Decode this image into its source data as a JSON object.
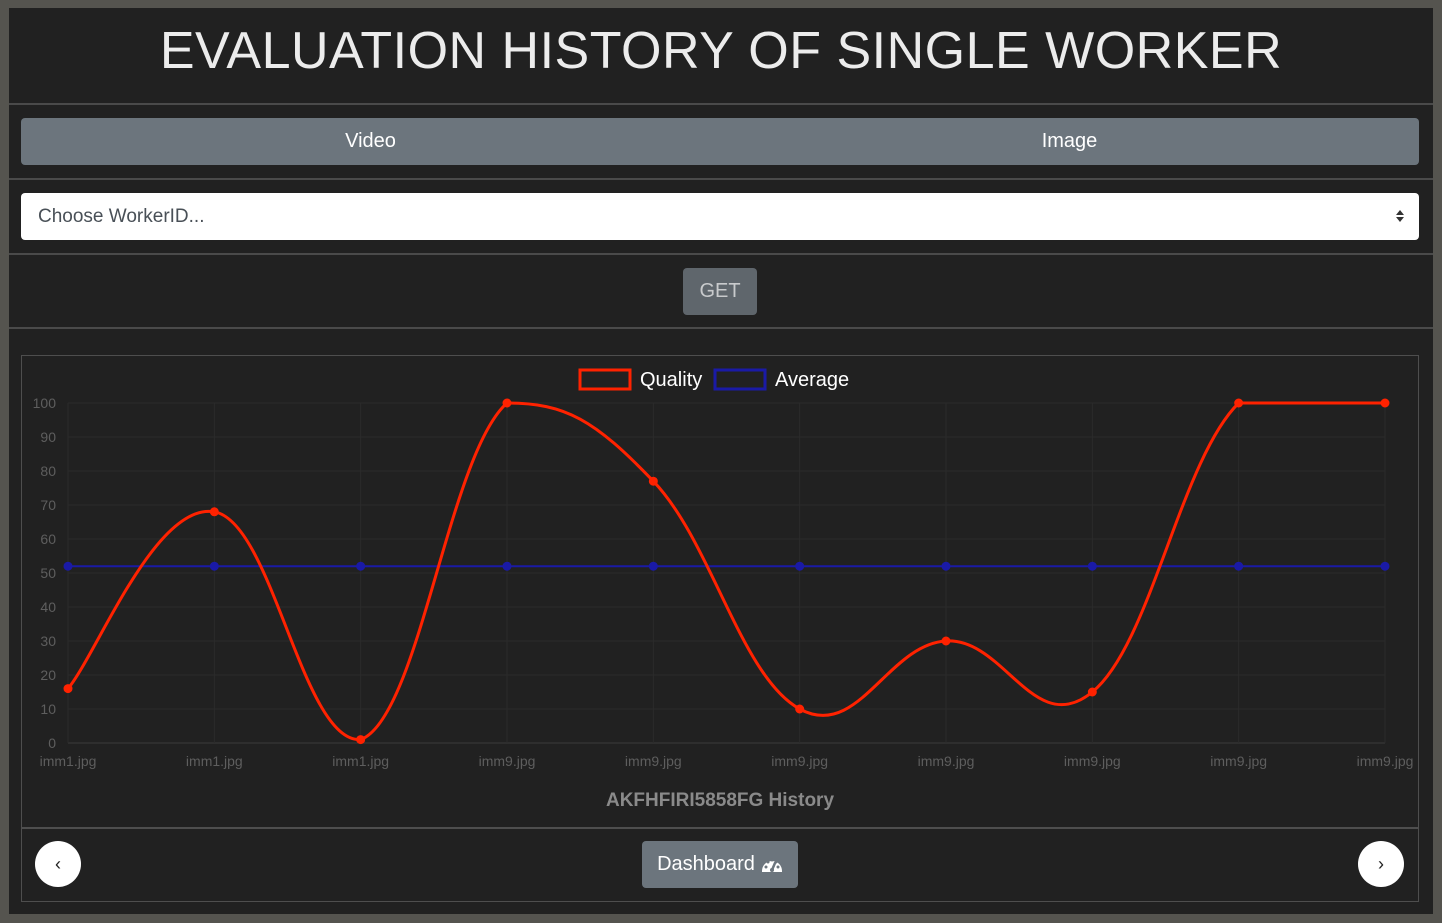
{
  "header": {
    "title": "EVALUATION HISTORY OF SINGLE WORKER"
  },
  "tabs": [
    {
      "label": "Video"
    },
    {
      "label": "Image"
    }
  ],
  "worker_select": {
    "placeholder": "Choose WorkerID..."
  },
  "get_button": {
    "label": "GET"
  },
  "footer": {
    "prev_label": "‹",
    "next_label": "›",
    "dashboard_label": "Dashboard",
    "dashboard_icon": "tachometer-icon"
  },
  "chart_data": {
    "type": "line",
    "title": "AKFHFIRI5858FG History",
    "categories": [
      "imm1.jpg",
      "imm1.jpg",
      "imm1.jpg",
      "imm9.jpg",
      "imm9.jpg",
      "imm9.jpg",
      "imm9.jpg",
      "imm9.jpg",
      "imm9.jpg",
      "imm9.jpg"
    ],
    "series": [
      {
        "name": "Quality",
        "values": [
          16,
          68,
          1,
          100,
          77,
          10,
          30,
          15,
          100,
          100
        ],
        "color": "#ff2200"
      },
      {
        "name": "Average",
        "values": [
          52,
          52,
          52,
          52,
          52,
          52,
          52,
          52,
          52,
          52
        ],
        "color": "#1a1aa6"
      }
    ],
    "ylim": [
      0,
      100
    ],
    "yticks": [
      0,
      10,
      20,
      30,
      40,
      50,
      60,
      70,
      80,
      90,
      100
    ],
    "xlabel": "",
    "ylabel": "",
    "grid": true,
    "legend": "top-center"
  },
  "colors": {
    "page_bg": "#212121",
    "frame_border": "#55544f",
    "tab_bg": "#6c757d",
    "button_bg": "#6c757d"
  }
}
